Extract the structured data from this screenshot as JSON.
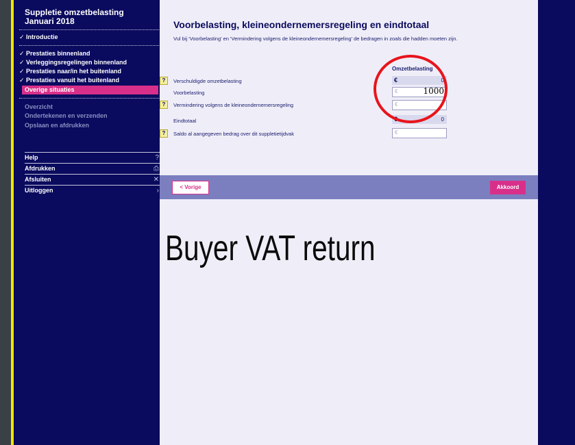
{
  "sidebar": {
    "title_line1": "Suppletie omzetbelasting",
    "title_line2": "Januari 2018",
    "steps": [
      {
        "label": "Introductie",
        "done": true
      },
      {
        "label": "Prestaties binnenland",
        "done": true
      },
      {
        "label": "Verleggingsregelingen binnenland",
        "done": true
      },
      {
        "label": "Prestaties naar/in het buitenland",
        "done": true
      },
      {
        "label": "Prestaties vanuit het buitenland",
        "done": true
      },
      {
        "label": "Overige situaties",
        "done": false,
        "active": true
      }
    ],
    "upcoming": [
      "Overzicht",
      "Ondertekenen en verzenden",
      "Opslaan en afdrukken"
    ],
    "menu": [
      {
        "label": "Help",
        "icon": "help-icon",
        "glyph": "?"
      },
      {
        "label": "Afdrukken",
        "icon": "print-icon",
        "glyph": "⎙"
      },
      {
        "label": "Afsluiten",
        "icon": "close-icon",
        "glyph": "✕"
      },
      {
        "label": "Uitloggen",
        "icon": "chevron-right-icon",
        "glyph": "›"
      }
    ]
  },
  "main": {
    "title": "Voorbelasting, kleineondernemersregeling en eindtotaal",
    "intro": "Vul bij 'Voorbelasting' en 'Vermindering volgens de kleineondernemersregeling' de bedragen in zoals die hadden moeten zijn.",
    "column_header": "Omzetbelasting",
    "currency": "€",
    "rows": [
      {
        "label": "Verschuldigde omzetbelasting",
        "value": "0",
        "help": "?"
      },
      {
        "label": "Voorbelasting",
        "value": "1000"
      },
      {
        "label": "Vermindering volgens de kleineondernemersregeling",
        "value": "",
        "help": "?"
      },
      {
        "label": "Eindtotaal",
        "value": "0"
      },
      {
        "label": "Saldo al aangegeven bedrag over dit suppletietijdvak",
        "value": "",
        "help": "?"
      }
    ],
    "prev_button": "< Vorige",
    "ok_button": "Akkoord"
  },
  "overlay_text": "Buyer VAT return",
  "colors": {
    "navy": "#0a0a5e",
    "magenta": "#d8308a",
    "band": "#7b7fc0",
    "annotation": "#e8141c",
    "yellow": "#f2e600"
  }
}
